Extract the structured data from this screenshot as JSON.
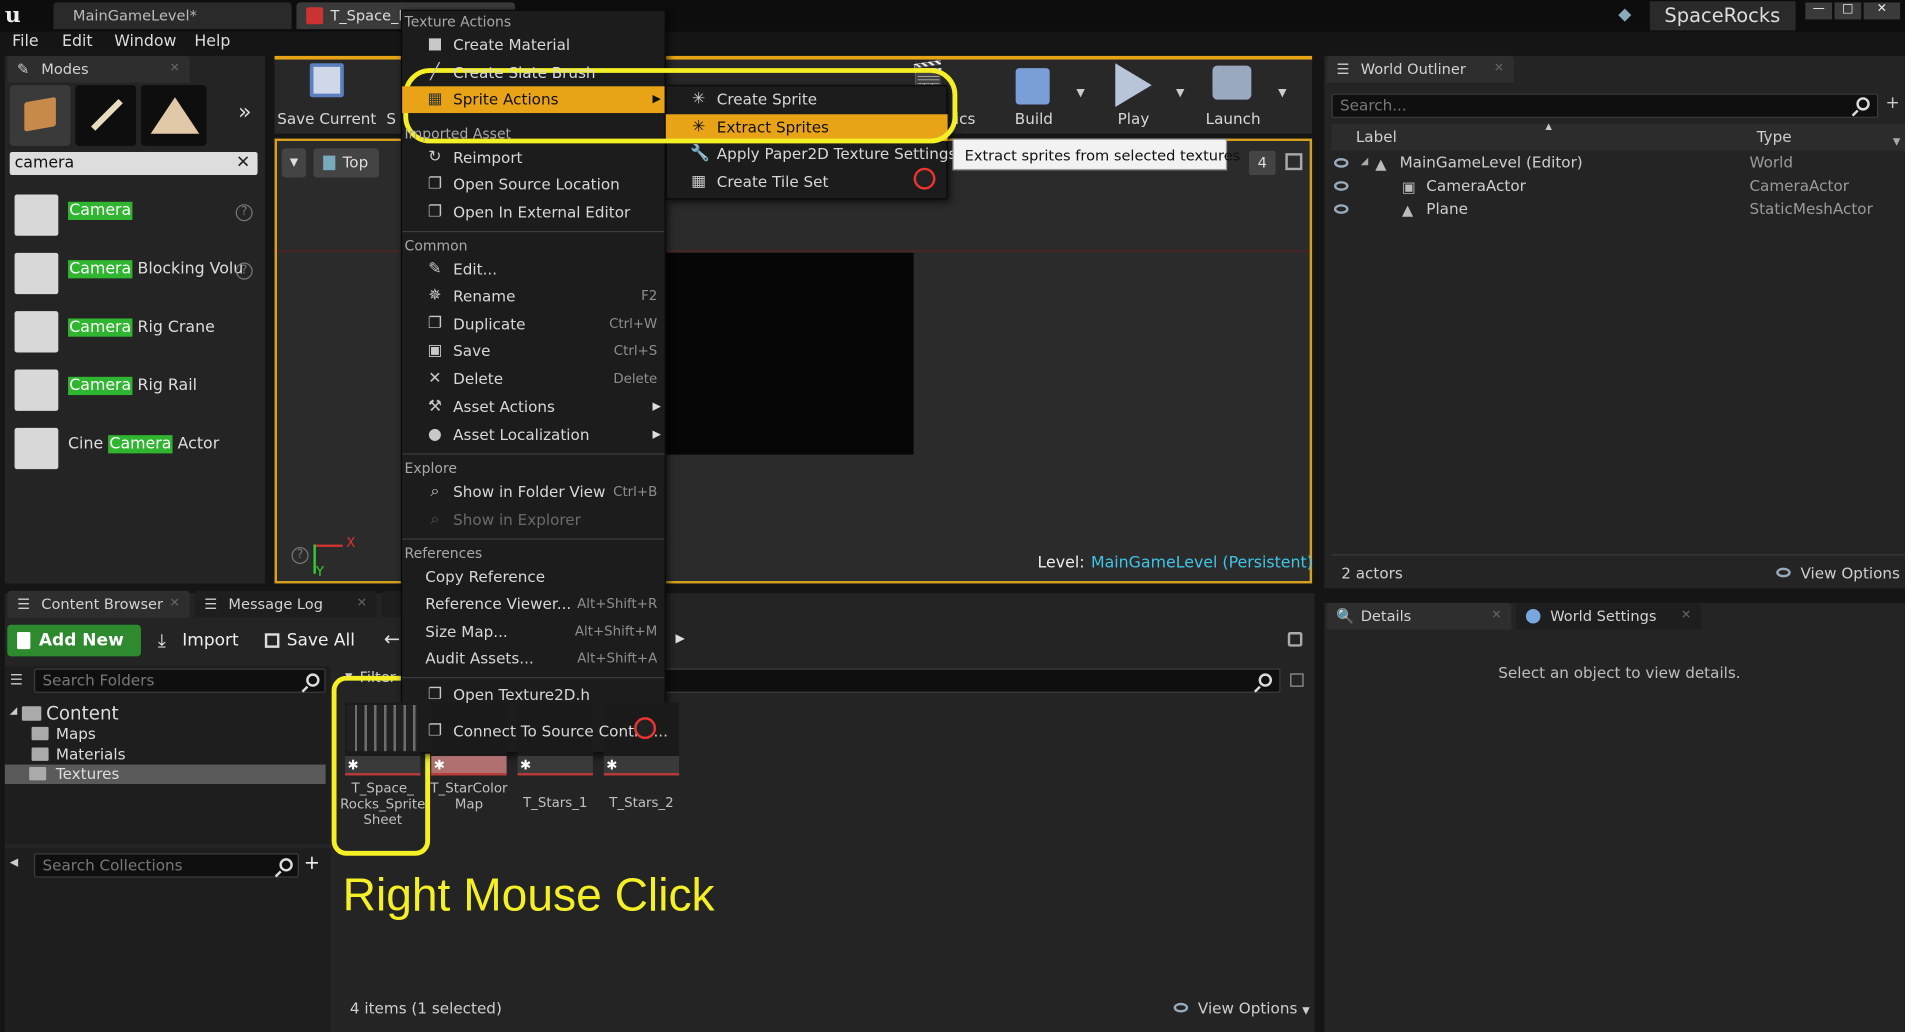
{
  "title_bar": {
    "tabs": [
      "MainGameLevel*",
      "T_Space_Rocks_Sprite_Sh..."
    ],
    "project_name": "SpaceRocks"
  },
  "menu_bar": [
    "File",
    "Edit",
    "Window",
    "Help"
  ],
  "modes": {
    "tab_label": "Modes",
    "search_value": "camera",
    "items": [
      {
        "highlight": "Camera",
        "rest": ""
      },
      {
        "highlight": "Camera",
        "rest": " Blocking Volu"
      },
      {
        "highlight": "Camera",
        "rest": " Rig Crane"
      },
      {
        "highlight": "Camera",
        "rest": " Rig Rail"
      },
      {
        "prefix": "Cine ",
        "highlight": "Camera",
        "rest": " Actor"
      }
    ]
  },
  "toolbar": {
    "save_current": "Save Current",
    "s_trunc": "S",
    "build": "Build",
    "play": "Play",
    "launch": "Launch",
    "ics_trunc": "ics"
  },
  "viewport": {
    "top_label": "Top",
    "level_prefix": "Level:",
    "level_name": "MainGameLevel (Persistent)",
    "num_badge": "4",
    "axis_x": "X",
    "axis_y": "Y"
  },
  "world_outliner": {
    "tab_label": "World Outliner",
    "search_placeholder": "Search...",
    "col_label": "Label",
    "col_type": "Type",
    "rows": [
      {
        "label": "MainGameLevel (Editor)",
        "type": "World"
      },
      {
        "label": "CameraActor",
        "type": "CameraActor"
      },
      {
        "label": "Plane",
        "type": "StaticMeshActor"
      }
    ],
    "actor_count": "2 actors",
    "view_options": "View Options"
  },
  "details": {
    "tab_details": "Details",
    "tab_world_settings": "World Settings",
    "empty_message": "Select an object to view details."
  },
  "content_browser": {
    "tab_label": "Content Browser",
    "tab_message_log": "Message Log",
    "add_new": "Add New",
    "import": "Import",
    "save_all": "Save All",
    "search_folders_placeholder": "Search Folders",
    "tree": [
      "Content",
      "Maps",
      "Materials",
      "Textures"
    ],
    "search_collections_placeholder": "Search Collections",
    "filters_trunc": "Filter",
    "assets": [
      {
        "name": "T_Space_\nRocks_Sprite\nSheet"
      },
      {
        "name": "T_StarColor\nMap"
      },
      {
        "name": "T_Stars_1"
      },
      {
        "name": "T_Stars_2"
      }
    ],
    "item_count": "4 items (1 selected)",
    "view_options": "View Options"
  },
  "context_menu": {
    "sec_texture_actions": "Texture Actions",
    "create_material": "Create Material",
    "create_slate_brush": "Create Slate Brush",
    "sprite_actions": "Sprite Actions",
    "sec_imported_asset": "Imported Asset",
    "reimport": "Reimport",
    "open_source_location": "Open Source Location",
    "open_external_editor": "Open In External Editor",
    "sec_common": "Common",
    "edit": "Edit...",
    "rename": "Rename",
    "rename_sc": "F2",
    "duplicate": "Duplicate",
    "duplicate_sc": "Ctrl+W",
    "save": "Save",
    "save_sc": "Ctrl+S",
    "delete": "Delete",
    "delete_sc": "Delete",
    "asset_actions": "Asset Actions",
    "asset_localization": "Asset Localization",
    "sec_explore": "Explore",
    "show_folder_view": "Show in Folder View",
    "show_folder_view_sc": "Ctrl+B",
    "show_explorer": "Show in Explorer",
    "sec_references": "References",
    "copy_reference": "Copy Reference",
    "reference_viewer": "Reference Viewer...",
    "reference_viewer_sc": "Alt+Shift+R",
    "size_map": "Size Map...",
    "size_map_sc": "Alt+Shift+M",
    "audit_assets": "Audit Assets...",
    "audit_assets_sc": "Alt+Shift+A",
    "open_header": "Open Texture2D.h",
    "connect_source_control": "Connect To Source Control..."
  },
  "submenu": {
    "create_sprite": "Create Sprite",
    "extract_sprites": "Extract Sprites",
    "apply_paper2d": "Apply Paper2D Texture Settings",
    "create_tile_set": "Create Tile Set",
    "tooltip": "Extract sprites from selected textures"
  },
  "annotation": {
    "text": "Right Mouse Click",
    "color": "#f4f025"
  },
  "colors": {
    "menu_highlight": "#e8a317",
    "search_highlight": "#2fb52f",
    "level_name": "#3fc6e8"
  }
}
